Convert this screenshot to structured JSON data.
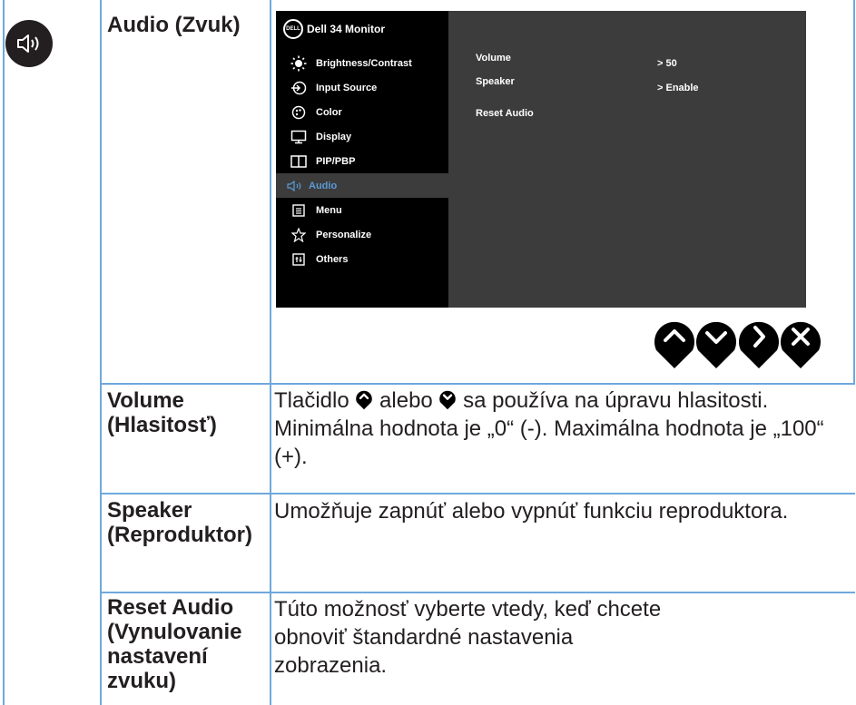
{
  "section": {
    "icon": "speaker-icon",
    "title": "Audio (Zvuk)"
  },
  "osd": {
    "header": "Dell 34 Monitor",
    "logo_text": "DELL",
    "menu": [
      {
        "label": "Brightness/Contrast",
        "icon": "brightness-icon"
      },
      {
        "label": "Input Source",
        "icon": "input-source-icon"
      },
      {
        "label": "Color",
        "icon": "color-palette-icon"
      },
      {
        "label": "Display",
        "icon": "display-monitor-icon"
      },
      {
        "label": "PIP/PBP",
        "icon": "pip-pbp-icon"
      },
      {
        "label": "Audio",
        "icon": "speaker-icon",
        "active": true
      },
      {
        "label": "Menu",
        "icon": "menu-list-icon"
      },
      {
        "label": "Personalize",
        "icon": "star-icon"
      },
      {
        "label": "Others",
        "icon": "others-icon"
      }
    ],
    "settings": [
      {
        "label": "Volume",
        "value": "> 50"
      },
      {
        "label": "Speaker",
        "value": "> Enable"
      },
      {
        "label": "Reset Audio",
        "value": ""
      }
    ],
    "accent_color": "#5b9bd5"
  },
  "buttons": [
    "up-arrow-icon",
    "down-arrow-icon",
    "right-arrow-icon",
    "close-icon"
  ],
  "rows": [
    {
      "label_lines": [
        "Volume",
        "(Hlasitosť)"
      ],
      "desc_parts": [
        "Tlačidlo ",
        " alebo ",
        " sa používa na úpravu hlasitosti. Minimálna hodnota je „0“ (-). Maximálna hodnota je „100“ (+)."
      ]
    },
    {
      "label_lines": [
        "Speaker",
        "(Reproduktor)"
      ],
      "desc": "Umožňuje zapnúť alebo vypnúť funkciu reproduktora."
    },
    {
      "label_lines": [
        "Reset Audio",
        "(Vynulovanie",
        "nastavení",
        "zvuku)"
      ],
      "desc": "Túto možnosť vyberte vtedy, keď chcete obnoviť štandardné nastavenia zobrazenia."
    }
  ]
}
